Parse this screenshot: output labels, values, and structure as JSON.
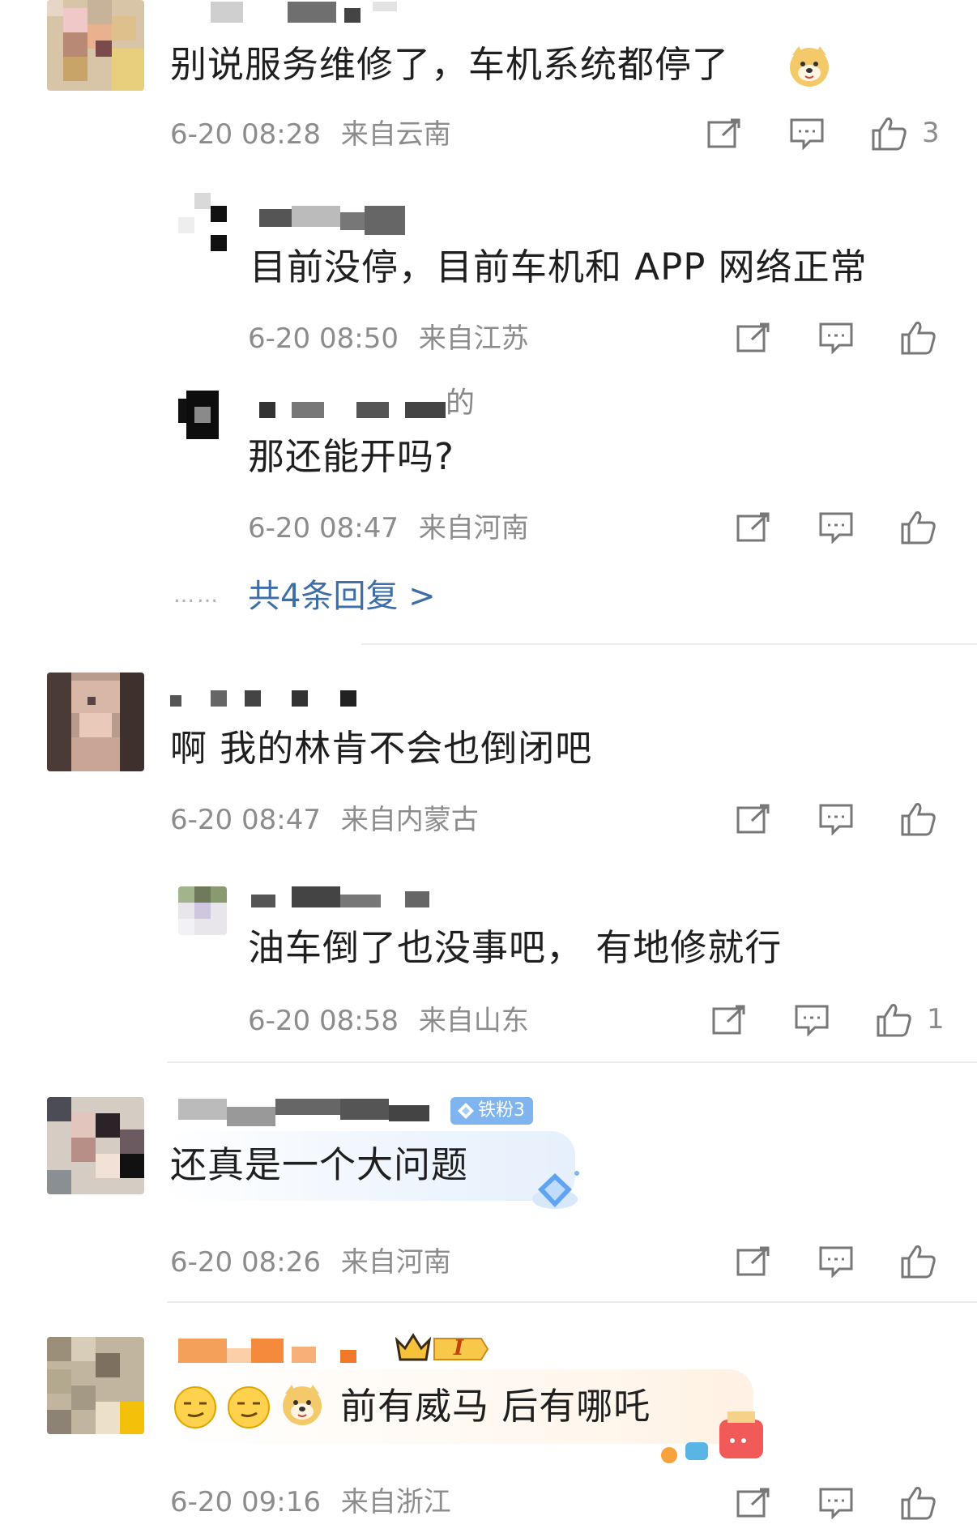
{
  "comments": [
    {
      "text": "别说服务维修了，车机系统都停了",
      "time": "6-20 08:28",
      "location": "来自云南",
      "likes": "3"
    },
    {
      "text": "目前没停，目前车机和 APP 网络正常",
      "time": "6-20 08:50",
      "location": "来自江苏"
    },
    {
      "text": "那还能开吗?",
      "time": "6-20 08:47",
      "location": "来自河南",
      "nick_suffix": "的"
    },
    {
      "text": "啊 我的林肯不会也倒闭吧",
      "time": "6-20 08:47",
      "location": "来自内蒙古"
    },
    {
      "text": "油车倒了也没事吧， 有地修就行",
      "time": "6-20 08:58",
      "location": "来自山东",
      "likes": "1"
    },
    {
      "text": "还真是一个大问题",
      "time": "6-20 08:26",
      "location": "来自河南",
      "badge": "铁粉3"
    },
    {
      "text": "前有威马 后有哪吒",
      "time": "6-20 09:16",
      "location": "来自浙江",
      "crown_level": "I"
    }
  ],
  "more_replies": {
    "dots": "……",
    "label": "共4条回复 >"
  },
  "icons": {
    "share": "share-icon",
    "comment": "comment-icon",
    "like": "thumbs-up-icon"
  },
  "colors": {
    "link": "#3d6ea8",
    "meta": "#8c8c8c",
    "badge": "#7fb4ef"
  }
}
